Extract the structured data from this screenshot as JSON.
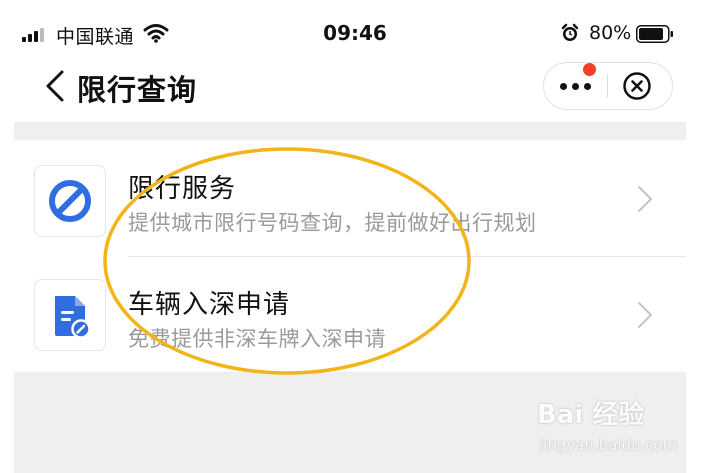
{
  "status_bar": {
    "carrier": "中国联通",
    "time": "09:46",
    "battery": "80%"
  },
  "nav": {
    "title": "限行查询",
    "icons": [
      "back-chevron-icon",
      "more-icon",
      "close-circle-icon"
    ]
  },
  "services": [
    {
      "title": "限行服务",
      "description": "提供城市限行号码查询，提前做好出行规划",
      "icon": "no-entry-icon"
    },
    {
      "title": "车辆入深申请",
      "description": "免费提供非深车牌入深申请",
      "icon": "document-edit-icon"
    }
  ],
  "watermark": {
    "main": "Bai 经验",
    "sub": "jingyan.baidu.com"
  },
  "colors": {
    "accent_blue": "#2f6de1",
    "annotation_yellow": "#f2b418",
    "badge_red": "#f0402a",
    "description_gray": "#9a9a9a"
  }
}
